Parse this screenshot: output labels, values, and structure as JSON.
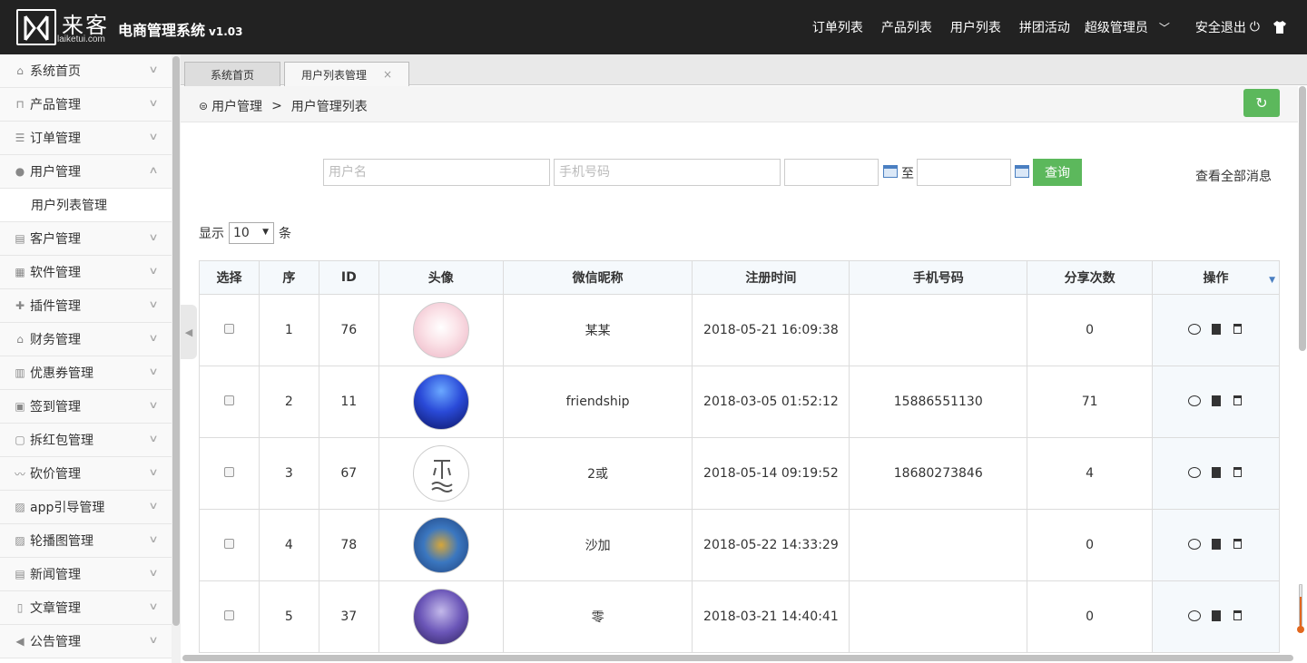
{
  "header": {
    "logo_cn": "来客",
    "logo_en": "laiketui.com",
    "title": "电商管理系统",
    "version": "v1.03",
    "nav": [
      "订单列表",
      "产品列表",
      "用户列表",
      "拼团活动"
    ],
    "admin": "超级管理员",
    "logout": "安全退出"
  },
  "sidebar": {
    "items": [
      {
        "label": "系统首页",
        "icon": "home-icon"
      },
      {
        "label": "产品管理",
        "icon": "bag-icon"
      },
      {
        "label": "订单管理",
        "icon": "list-icon"
      },
      {
        "label": "用户管理",
        "icon": "user-icon"
      },
      {
        "label": "客户管理",
        "icon": "box-icon"
      },
      {
        "label": "软件管理",
        "icon": "grid-icon"
      },
      {
        "label": "插件管理",
        "icon": "puzzle-icon"
      },
      {
        "label": "财务管理",
        "icon": "bank-icon"
      },
      {
        "label": "优惠券管理",
        "icon": "coupon-icon"
      },
      {
        "label": "签到管理",
        "icon": "calendar-icon"
      },
      {
        "label": "拆红包管理",
        "icon": "envelope-icon"
      },
      {
        "label": "砍价管理",
        "icon": "wave-icon"
      },
      {
        "label": "app引导管理",
        "icon": "image-icon"
      },
      {
        "label": "轮播图管理",
        "icon": "picture-icon"
      },
      {
        "label": "新闻管理",
        "icon": "news-icon"
      },
      {
        "label": "文章管理",
        "icon": "file-icon"
      },
      {
        "label": "公告管理",
        "icon": "megaphone-icon"
      }
    ],
    "sub_item": "用户列表管理"
  },
  "tabs": [
    {
      "label": "系统首页"
    },
    {
      "label": "用户列表管理",
      "close": "×"
    }
  ],
  "breadcrumb": {
    "root": "用户管理",
    "sep": ">",
    "current": "用户管理列表"
  },
  "search": {
    "username_placeholder": "用户名",
    "phone_placeholder": "手机号码",
    "to_label": "至",
    "query_label": "查询",
    "view_all": "查看全部消息"
  },
  "length": {
    "prefix": "显示",
    "value": "10",
    "suffix": "条"
  },
  "table": {
    "columns": [
      "选择",
      "序",
      "ID",
      "头像",
      "微信昵称",
      "注册时间",
      "手机号码",
      "分享次数",
      "操作"
    ],
    "rows": [
      {
        "seq": "1",
        "id": "76",
        "nick": "某某",
        "time": "2018-05-21 16:09:38",
        "phone": "",
        "shares": "0"
      },
      {
        "seq": "2",
        "id": "11",
        "nick": "friendship",
        "time": "2018-03-05 01:52:12",
        "phone": "15886551130",
        "shares": "71"
      },
      {
        "seq": "3",
        "id": "67",
        "nick": "2或",
        "time": "2018-05-14 09:19:52",
        "phone": "18680273846",
        "shares": "4"
      },
      {
        "seq": "4",
        "id": "78",
        "nick": "沙加",
        "time": "2018-05-22 14:33:29",
        "phone": "",
        "shares": "0"
      },
      {
        "seq": "5",
        "id": "37",
        "nick": "零",
        "time": "2018-03-21 14:40:41",
        "phone": "",
        "shares": "0"
      }
    ]
  },
  "colors": {
    "header_bg": "#222222",
    "accent_green": "#5cb85c",
    "table_header_bg": "#f5f9fc"
  }
}
